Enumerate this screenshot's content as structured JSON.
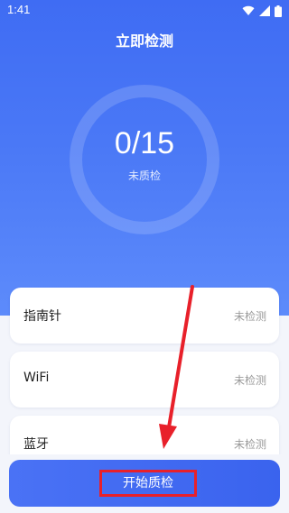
{
  "status_bar": {
    "time": "1:41"
  },
  "header": {
    "title": "立即检测"
  },
  "progress": {
    "count_text": "0/15",
    "checked": 0,
    "total": 15,
    "status": "未质检"
  },
  "checks": [
    {
      "name": "指南针",
      "state": "未检测"
    },
    {
      "name": "WiFi",
      "state": "未检测"
    },
    {
      "name": "蓝牙",
      "state": "未检测"
    }
  ],
  "action": {
    "start_label": "开始质检"
  },
  "colors": {
    "primary": "#3f6cf3",
    "annotation": "#e8202a"
  }
}
